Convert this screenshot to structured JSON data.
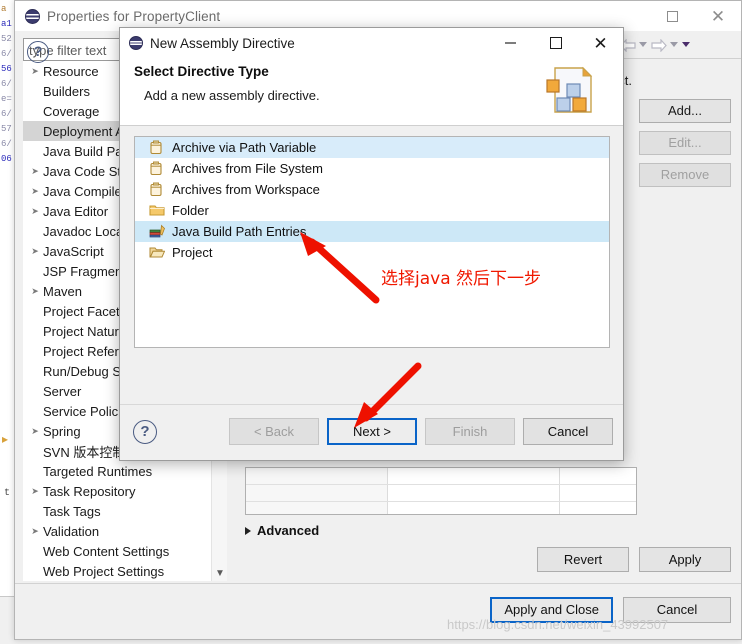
{
  "background": {
    "code_lines": [
      "a",
      "a1",
      "52",
      "6/",
      "56",
      "6/",
      "e=",
      "",
      "6/",
      "57",
      "6/",
      "06"
    ]
  },
  "properties_window": {
    "title": "Properties for PropertyClient",
    "icons": {
      "app": "eclipse-icon",
      "maximize": "maximize-icon",
      "close": "close-icon"
    },
    "toolbar": {
      "back": "back-arrow-icon",
      "back_menu": "chevron-down-icon",
      "forward": "forward-arrow-icon",
      "forward_menu": "chevron-down-icon",
      "view_menu": "chevron-down-icon"
    },
    "filter": {
      "placeholder": "type filter text",
      "value": ""
    },
    "tree_items": [
      {
        "label": "Resource",
        "expandable": true,
        "selected": false
      },
      {
        "label": "Builders",
        "expandable": false,
        "selected": false
      },
      {
        "label": "Coverage",
        "expandable": false,
        "selected": false
      },
      {
        "label": "Deployment Assembly",
        "expandable": false,
        "selected": true
      },
      {
        "label": "Java Build Path",
        "expandable": false,
        "selected": false
      },
      {
        "label": "Java Code Style",
        "expandable": true,
        "selected": false
      },
      {
        "label": "Java Compiler",
        "expandable": true,
        "selected": false
      },
      {
        "label": "Java Editor",
        "expandable": true,
        "selected": false
      },
      {
        "label": "Javadoc Location",
        "expandable": false,
        "selected": false
      },
      {
        "label": "JavaScript",
        "expandable": true,
        "selected": false
      },
      {
        "label": "JSP Fragment",
        "expandable": false,
        "selected": false
      },
      {
        "label": "Maven",
        "expandable": true,
        "selected": false
      },
      {
        "label": "Project Facets",
        "expandable": false,
        "selected": false
      },
      {
        "label": "Project Natures",
        "expandable": false,
        "selected": false
      },
      {
        "label": "Project References",
        "expandable": false,
        "selected": false
      },
      {
        "label": "Run/Debug Settings",
        "expandable": false,
        "selected": false
      },
      {
        "label": "Server",
        "expandable": false,
        "selected": false
      },
      {
        "label": "Service Policies",
        "expandable": false,
        "selected": false
      },
      {
        "label": "Spring",
        "expandable": true,
        "selected": false
      },
      {
        "label": "SVN 版本控制",
        "expandable": false,
        "selected": false
      },
      {
        "label": "Targeted Runtimes",
        "expandable": false,
        "selected": false
      },
      {
        "label": "Task Repository",
        "expandable": true,
        "selected": false
      },
      {
        "label": "Task Tags",
        "expandable": false,
        "selected": false
      },
      {
        "label": "Validation",
        "expandable": true,
        "selected": false
      },
      {
        "label": "Web Content Settings",
        "expandable": false,
        "selected": false
      },
      {
        "label": "Web Project Settings",
        "expandable": false,
        "selected": false
      }
    ],
    "right_panel": {
      "description_fragment": "ect.",
      "buttons": [
        {
          "label": "Add...",
          "enabled": true
        },
        {
          "label": "Edit...",
          "enabled": false
        },
        {
          "label": "Remove",
          "enabled": false
        }
      ],
      "advanced_label": "Advanced",
      "revert_label": "Revert",
      "apply_label": "Apply"
    },
    "footer": {
      "help": "help-icon",
      "apply_and_close_label": "Apply and Close",
      "cancel_label": "Cancel"
    }
  },
  "assembly_dialog": {
    "title": "New Assembly Directive",
    "icons": {
      "app": "eclipse-icon",
      "minimize": "minimize-icon",
      "maximize": "maximize-icon",
      "close": "close-icon"
    },
    "banner": {
      "heading": "Select Directive Type",
      "subheading": "Add a new assembly directive.",
      "icon": "assembly-document-icon"
    },
    "list": [
      {
        "label": "Archive via Path Variable",
        "icon": "jar-icon",
        "selected": false,
        "highlighted": true
      },
      {
        "label": "Archives from File System",
        "icon": "jar-icon",
        "selected": false,
        "highlighted": false
      },
      {
        "label": "Archives from Workspace",
        "icon": "jar-icon",
        "selected": false,
        "highlighted": false
      },
      {
        "label": "Folder",
        "icon": "folder-icon",
        "selected": false,
        "highlighted": false
      },
      {
        "label": "Java Build Path Entries",
        "icon": "java-build-path-icon",
        "selected": true,
        "highlighted": false
      },
      {
        "label": "Project",
        "icon": "project-folder-icon",
        "selected": false,
        "highlighted": false
      }
    ],
    "footer": {
      "help": "help-icon",
      "back_label": "< Back",
      "back_enabled": false,
      "next_label": "Next >",
      "next_enabled": true,
      "next_default": true,
      "finish_label": "Finish",
      "finish_enabled": false,
      "cancel_label": "Cancel",
      "cancel_enabled": true
    }
  },
  "annotations": {
    "chinese_note": "选择java 然后下一步",
    "note_color": "#f01800",
    "arrows": [
      {
        "name": "arrow-to-java-build-path"
      },
      {
        "name": "arrow-to-next-button"
      }
    ]
  },
  "watermark": {
    "text": "https://blog.csdn.net/weixin_43992507"
  }
}
